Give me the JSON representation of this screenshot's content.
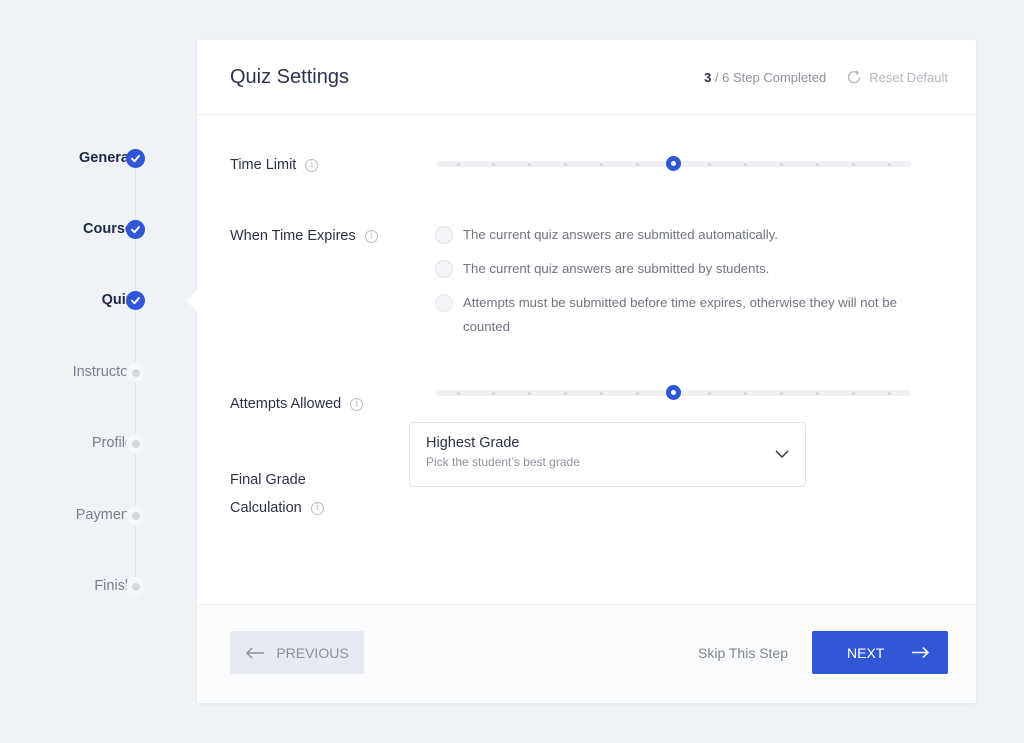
{
  "stepper": {
    "steps": [
      {
        "label": "General",
        "status": "done"
      },
      {
        "label": "Course",
        "status": "done"
      },
      {
        "label": "Quiz",
        "status": "done"
      },
      {
        "label": "Instructor",
        "status": "pending"
      },
      {
        "label": "Profile",
        "status": "pending"
      },
      {
        "label": "Payment",
        "status": "pending"
      },
      {
        "label": "Finish",
        "status": "pending"
      }
    ]
  },
  "header": {
    "title": "Quiz Settings",
    "progress_current": "3",
    "progress_rest": " / 6 Step Completed",
    "reset_label": "Reset Default"
  },
  "fields": {
    "time_limit": {
      "label": "Time Limit",
      "slider": {
        "steps": 13,
        "selected_index": 6
      }
    },
    "when_time_expires": {
      "label": "When Time Expires",
      "options": [
        {
          "label": "The current quiz answers are submitted automatically.",
          "checked": false
        },
        {
          "label": "The current quiz answers are submitted by students.",
          "checked": false
        },
        {
          "label": "Attempts must be submitted before time expires, otherwise they will not be counted",
          "checked": false
        }
      ]
    },
    "attempts_allowed": {
      "label": "Attempts Allowed",
      "slider": {
        "steps": 13,
        "selected_index": 6
      }
    },
    "final_grade": {
      "label_line1": "Final Grade",
      "label_line2": "Calculation",
      "selected_value": "Highest Grade",
      "selected_description": "Pick the student’s best grade"
    }
  },
  "footer": {
    "previous_label": "PREVIOUS",
    "skip_label": "Skip This Step",
    "next_label": "NEXT"
  },
  "colors": {
    "accent": "#2f57d6",
    "background": "#eff2f6",
    "card": "#ffffff"
  }
}
